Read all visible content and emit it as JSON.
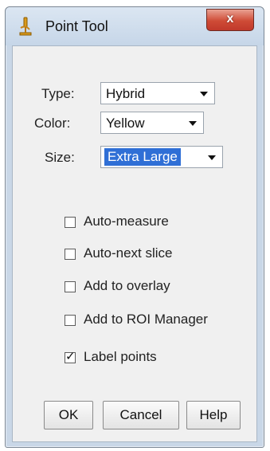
{
  "window": {
    "title": "Point Tool",
    "close_label": "x"
  },
  "form": {
    "type": {
      "label": "Type:",
      "value": "Hybrid"
    },
    "color": {
      "label": "Color:",
      "value": "Yellow"
    },
    "size": {
      "label": "Size:",
      "value": "Extra Large"
    }
  },
  "options": [
    {
      "label": "Auto-measure",
      "checked": false
    },
    {
      "label": "Auto-next slice",
      "checked": false
    },
    {
      "label": "Add to overlay",
      "checked": false
    },
    {
      "label": "Add to ROI Manager",
      "checked": false
    },
    {
      "label": "Label points",
      "checked": true
    }
  ],
  "buttons": {
    "ok": "OK",
    "cancel": "Cancel",
    "help": "Help"
  },
  "colors": {
    "title_bg": "#c6d6e8",
    "close_red": "#cf4b36",
    "selection_blue": "#2f6fd6",
    "client_bg": "#f0f0f0"
  }
}
